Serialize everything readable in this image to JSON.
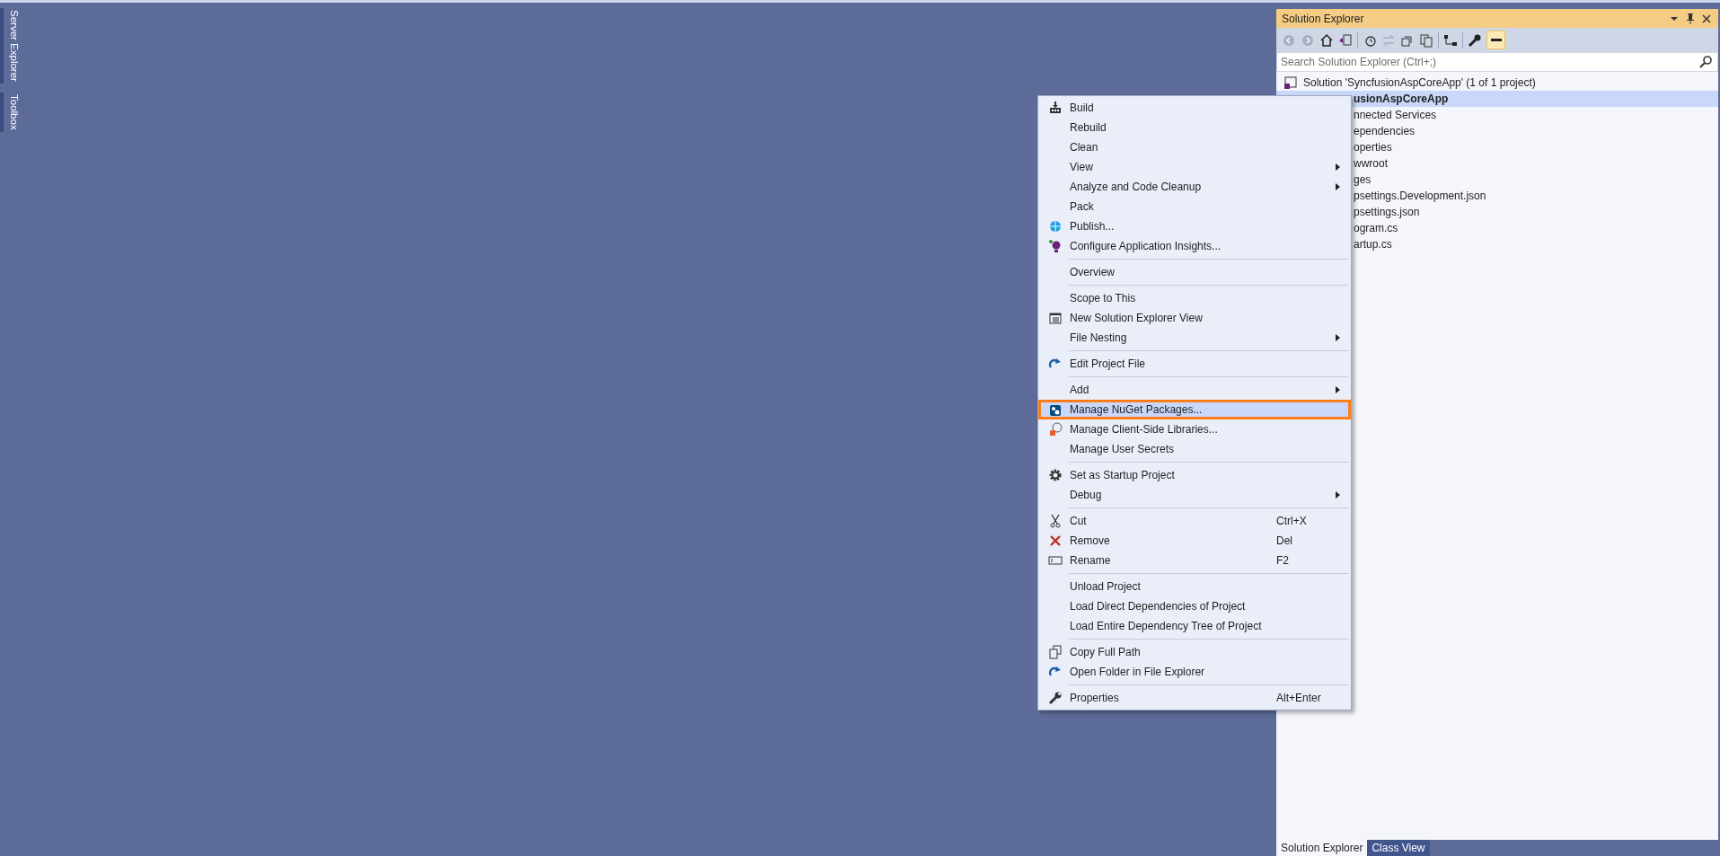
{
  "side_tabs": [
    {
      "label": "Server Explorer"
    },
    {
      "label": "Toolbox"
    }
  ],
  "solution_explorer": {
    "title": "Solution Explorer",
    "search": {
      "placeholder": "Search Solution Explorer (Ctrl+;)"
    },
    "tree": [
      {
        "label": "Solution 'SyncfusionAspCoreApp' (1 of 1 project)",
        "selected": false,
        "children": [
          {
            "label": "usionAspCoreApp",
            "selected": true,
            "children": [
              {
                "label": "nnected Services",
                "selected": false
              },
              {
                "label": "ependencies",
                "selected": false
              },
              {
                "label": "operties",
                "selected": false
              },
              {
                "label": "wwroot",
                "selected": false
              },
              {
                "label": "ges",
                "selected": false
              },
              {
                "label": "psettings.Development.json",
                "selected": false
              },
              {
                "label": "psettings.json",
                "selected": false
              },
              {
                "label": "ogram.cs",
                "selected": false
              },
              {
                "label": "artup.cs",
                "selected": false
              }
            ]
          }
        ]
      }
    ],
    "bottom_tabs": [
      {
        "label": "Solution Explorer",
        "selected": true
      },
      {
        "label": "Class View",
        "selected": false
      }
    ]
  },
  "context_menu": [
    {
      "kind": "item",
      "label": "Build",
      "submenu": false,
      "selected": false
    },
    {
      "kind": "item",
      "label": "Rebuild",
      "submenu": false,
      "selected": false
    },
    {
      "kind": "item",
      "label": "Clean",
      "submenu": false,
      "selected": false
    },
    {
      "kind": "item",
      "label": "View",
      "submenu": true,
      "selected": false
    },
    {
      "kind": "item",
      "label": "Analyze and Code Cleanup",
      "submenu": true,
      "selected": false
    },
    {
      "kind": "item",
      "label": "Pack",
      "submenu": false,
      "selected": false
    },
    {
      "kind": "item",
      "label": "Publish...",
      "submenu": false,
      "selected": false
    },
    {
      "kind": "item",
      "label": "Configure Application Insights...",
      "submenu": false,
      "selected": false
    },
    {
      "kind": "separator"
    },
    {
      "kind": "item",
      "label": "Overview",
      "submenu": false,
      "selected": false
    },
    {
      "kind": "separator"
    },
    {
      "kind": "item",
      "label": "Scope to This",
      "submenu": false,
      "selected": false
    },
    {
      "kind": "item",
      "label": "New Solution Explorer View",
      "submenu": false,
      "selected": false
    },
    {
      "kind": "item",
      "label": "File Nesting",
      "submenu": true,
      "selected": false
    },
    {
      "kind": "separator"
    },
    {
      "kind": "item",
      "label": "Edit Project File",
      "submenu": false,
      "selected": false
    },
    {
      "kind": "separator"
    },
    {
      "kind": "item",
      "label": "Add",
      "submenu": true,
      "selected": false
    },
    {
      "kind": "item",
      "label": "Manage NuGet Packages...",
      "submenu": false,
      "selected": true
    },
    {
      "kind": "item",
      "label": "Manage Client-Side Libraries...",
      "submenu": false,
      "selected": false
    },
    {
      "kind": "item",
      "label": "Manage User Secrets",
      "submenu": false,
      "selected": false
    },
    {
      "kind": "separator"
    },
    {
      "kind": "item",
      "label": "Set as Startup Project",
      "submenu": false,
      "selected": false
    },
    {
      "kind": "item",
      "label": "Debug",
      "submenu": true,
      "selected": false
    },
    {
      "kind": "separator"
    },
    {
      "kind": "item",
      "label": "Cut",
      "shortcut": "Ctrl+X",
      "submenu": false,
      "selected": false
    },
    {
      "kind": "item",
      "label": "Remove",
      "shortcut": "Del",
      "submenu": false,
      "selected": false
    },
    {
      "kind": "item",
      "label": "Rename",
      "shortcut": "F2",
      "submenu": false,
      "selected": false
    },
    {
      "kind": "separator"
    },
    {
      "kind": "item",
      "label": "Unload Project",
      "submenu": false,
      "selected": false
    },
    {
      "kind": "item",
      "label": "Load Direct Dependencies of Project",
      "submenu": false,
      "selected": false
    },
    {
      "kind": "item",
      "label": "Load Entire Dependency Tree of Project",
      "submenu": false,
      "selected": false
    },
    {
      "kind": "separator"
    },
    {
      "kind": "item",
      "label": "Copy Full Path",
      "submenu": false,
      "selected": false
    },
    {
      "kind": "item",
      "label": "Open Folder in File Explorer",
      "submenu": false,
      "selected": false
    },
    {
      "kind": "separator"
    },
    {
      "kind": "item",
      "label": "Properties",
      "shortcut": "Alt+Enter",
      "submenu": false,
      "selected": false
    }
  ]
}
